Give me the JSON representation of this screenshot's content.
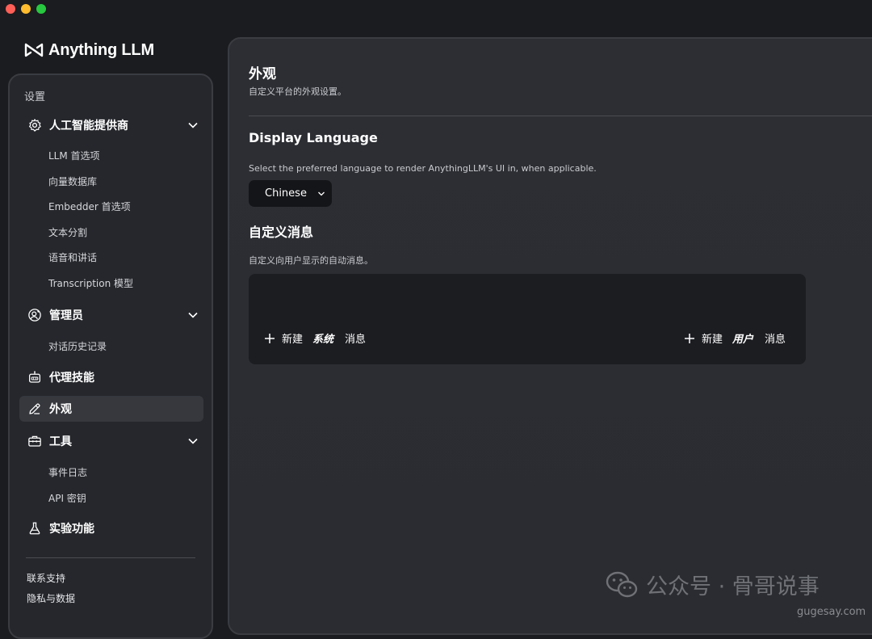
{
  "app": {
    "name": "Anything LLM"
  },
  "sidebar": {
    "heading": "设置",
    "groups": [
      {
        "label": "人工智能提供商",
        "icon": "gear-icon",
        "expanded": true,
        "items": [
          "LLM 首选项",
          "向量数据库",
          "Embedder 首选项",
          "文本分割",
          "语音和讲话",
          "Transcription 模型"
        ]
      },
      {
        "label": "管理员",
        "icon": "user-admin-icon",
        "expanded": true,
        "items": [
          "对话历史记录"
        ]
      },
      {
        "label": "代理技能",
        "icon": "robot-icon"
      },
      {
        "label": "外观",
        "icon": "pencil-icon",
        "active": true
      },
      {
        "label": "工具",
        "icon": "toolbox-icon",
        "expanded": true,
        "items": [
          "事件日志",
          "API 密钥"
        ]
      },
      {
        "label": "实验功能",
        "icon": "flask-icon"
      }
    ],
    "footer": [
      "联系支持",
      "隐私与数据"
    ]
  },
  "main": {
    "title": "外观",
    "subtitle": "自定义平台的外观设置。",
    "language": {
      "title": "Display Language",
      "description": "Select the preferred language to render AnythingLLM's UI in, when applicable.",
      "selected": "Chinese"
    },
    "messages": {
      "title": "自定义消息",
      "description": "自定义向用户显示的自动消息。",
      "new_system": {
        "prefix": "新建",
        "kind": "系统",
        "suffix": "消息"
      },
      "new_user": {
        "prefix": "新建",
        "kind": "用户",
        "suffix": "消息"
      }
    }
  },
  "watermark": {
    "text": "公众号 · 骨哥说事",
    "site": "gugesay.com"
  },
  "colors": {
    "background": "#1b1c1f",
    "sidebar": "#25272c",
    "panel": "#2b2d33",
    "select": "#141518"
  }
}
